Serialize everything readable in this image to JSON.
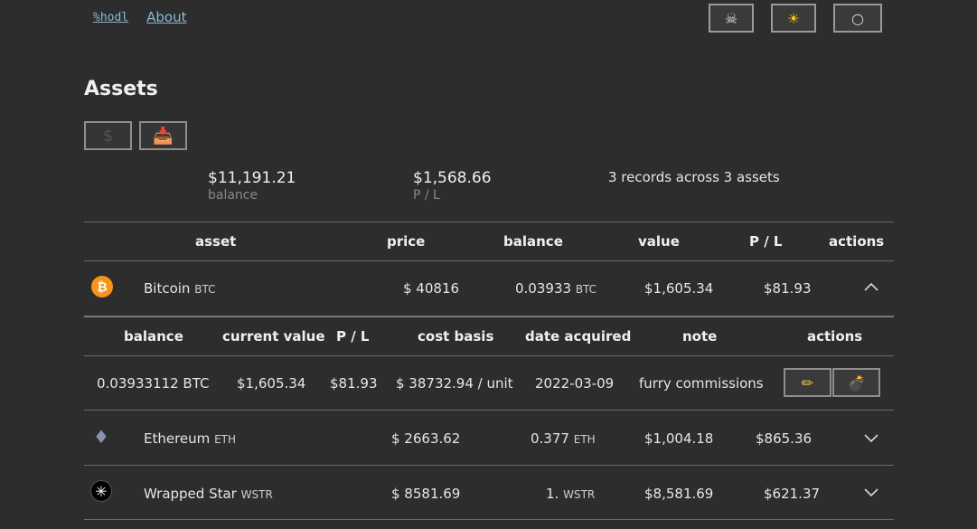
{
  "nav": {
    "home": "%hodl",
    "about": "About"
  },
  "top_buttons": [
    {
      "icon": "skull-icon",
      "glyph": "☠"
    },
    {
      "icon": "sun-icon",
      "glyph": "☀"
    },
    {
      "icon": "circle-icon",
      "glyph": "○"
    }
  ],
  "title": "Assets",
  "toolbar": [
    {
      "icon": "dollar-icon",
      "glyph": "$"
    },
    {
      "icon": "import-icon",
      "glyph": "📥"
    }
  ],
  "summary": {
    "balance_value": "$11,191.21",
    "balance_label": "balance",
    "pl_value": "$1,568.66",
    "pl_label": "P / L",
    "records_text": "3 records across 3 assets"
  },
  "table": {
    "headers": {
      "asset": "asset",
      "price": "price",
      "balance": "balance",
      "value": "value",
      "pl": "P / L",
      "actions": "actions"
    },
    "rows": [
      {
        "name": "Bitcoin",
        "symbol": "BTC",
        "price": "$ 40816",
        "balance": "0.03933",
        "balance_unit": "BTC",
        "value": "$1,605.34",
        "pl": "$81.93",
        "expanded": true
      },
      {
        "name": "Ethereum",
        "symbol": "ETH",
        "price": "$ 2663.62",
        "balance": "0.377",
        "balance_unit": "ETH",
        "value": "$1,004.18",
        "pl": "$865.36",
        "expanded": false
      },
      {
        "name": "Wrapped Star",
        "symbol": "WSTR",
        "price": "$ 8581.69",
        "balance": "1.",
        "balance_unit": "WSTR",
        "value": "$8,581.69",
        "pl": "$621.37",
        "expanded": false
      }
    ]
  },
  "records": {
    "headers": {
      "balance": "balance",
      "current_value": "current value",
      "pl": "P / L",
      "cost_basis": "cost basis",
      "date_acquired": "date acquired",
      "note": "note",
      "actions": "actions"
    },
    "rows": [
      {
        "balance": "0.03933112 BTC",
        "current_value": "$1,605.34",
        "pl": "$81.93",
        "cost_basis": "$ 38732.94 / unit",
        "date_acquired": "2022-03-09",
        "note": "furry commissions",
        "edit_icon": "pencil-icon",
        "edit_glyph": "✏",
        "delete_icon": "bomb-icon",
        "delete_glyph": "💣"
      }
    ]
  },
  "colors": {
    "background": "#2d2d2d",
    "link": "#8ab8d4",
    "bitcoin": "#f7931a",
    "ethereum": "#8a92b2"
  }
}
